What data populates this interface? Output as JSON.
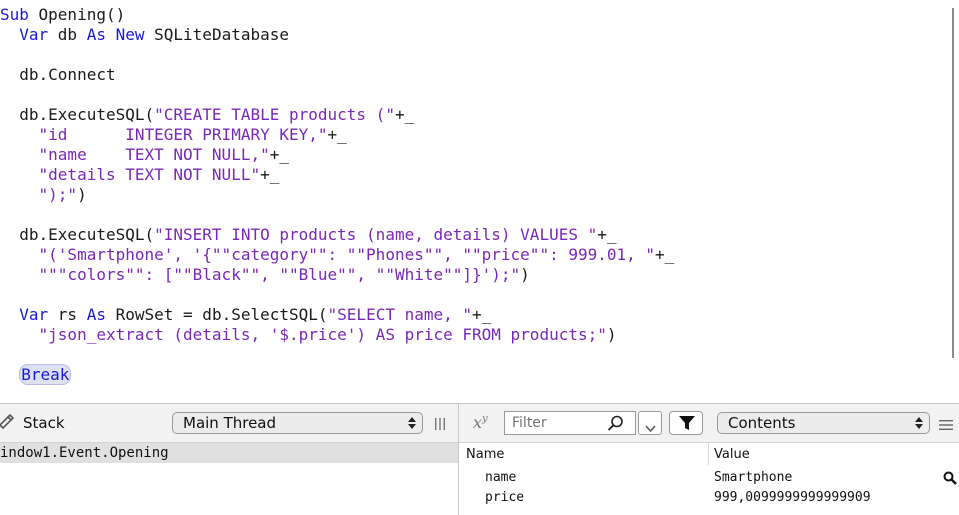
{
  "editor": {
    "lines": [
      [
        {
          "t": "Sub ",
          "c": "kw"
        },
        {
          "t": "Opening()",
          "c": "pl"
        }
      ],
      [
        {
          "t": "  ",
          "c": "pl"
        },
        {
          "t": "Var ",
          "c": "kw"
        },
        {
          "t": "db ",
          "c": "pl"
        },
        {
          "t": "As New ",
          "c": "kw"
        },
        {
          "t": "SQLiteDatabase",
          "c": "pl"
        }
      ],
      [],
      [
        {
          "t": "  db.Connect",
          "c": "pl"
        }
      ],
      [],
      [
        {
          "t": "  db.ExecuteSQL(",
          "c": "pl"
        },
        {
          "t": "\"CREATE TABLE products (\"",
          "c": "str"
        },
        {
          "t": "+_",
          "c": "pl"
        }
      ],
      [
        {
          "t": "    ",
          "c": "pl"
        },
        {
          "t": "\"id      INTEGER PRIMARY KEY,\"",
          "c": "str"
        },
        {
          "t": "+_",
          "c": "pl"
        }
      ],
      [
        {
          "t": "    ",
          "c": "pl"
        },
        {
          "t": "\"name    TEXT NOT NULL,\"",
          "c": "str"
        },
        {
          "t": "+_",
          "c": "pl"
        }
      ],
      [
        {
          "t": "    ",
          "c": "pl"
        },
        {
          "t": "\"details TEXT NOT NULL\"",
          "c": "str"
        },
        {
          "t": "+_",
          "c": "pl"
        }
      ],
      [
        {
          "t": "    ",
          "c": "pl"
        },
        {
          "t": "\");\"",
          "c": "str"
        },
        {
          "t": ")",
          "c": "pl"
        }
      ],
      [],
      [
        {
          "t": "  db.ExecuteSQL(",
          "c": "pl"
        },
        {
          "t": "\"INSERT INTO products (name, details) VALUES \"",
          "c": "str"
        },
        {
          "t": "+_",
          "c": "pl"
        }
      ],
      [
        {
          "t": "    ",
          "c": "pl"
        },
        {
          "t": "\"('Smartphone', '{\"\"category\"\": \"\"Phones\"\", \"\"price\"\": 999.01, \"",
          "c": "str"
        },
        {
          "t": "+_",
          "c": "pl"
        }
      ],
      [
        {
          "t": "    ",
          "c": "pl"
        },
        {
          "t": "\"\"\"colors\"\": [\"\"Black\"\", \"\"Blue\"\", \"\"White\"\"]}');\"",
          "c": "str"
        },
        {
          "t": ")",
          "c": "pl"
        }
      ],
      [],
      [
        {
          "t": "  ",
          "c": "pl"
        },
        {
          "t": "Var ",
          "c": "kw"
        },
        {
          "t": "rs ",
          "c": "pl"
        },
        {
          "t": "As ",
          "c": "kw"
        },
        {
          "t": "RowSet = db.SelectSQL(",
          "c": "pl"
        },
        {
          "t": "\"SELECT name, \"",
          "c": "str"
        },
        {
          "t": "+_",
          "c": "pl"
        }
      ],
      [
        {
          "t": "    ",
          "c": "pl"
        },
        {
          "t": "\"json_extract (details, '$.price') AS price FROM products;\"",
          "c": "str"
        },
        {
          "t": ")",
          "c": "pl"
        }
      ],
      [],
      [
        {
          "t": "  ",
          "c": "pl"
        },
        {
          "t": "Break",
          "c": "brk"
        }
      ]
    ]
  },
  "stack_panel": {
    "title": "Stack",
    "thread_selected": "Main Thread",
    "rows": [
      "indow1.Event.Opening"
    ]
  },
  "variables_panel": {
    "filter_placeholder": "Filter",
    "view_selected": "Contents",
    "col_name": "Name",
    "col_value": "Value",
    "rows": [
      {
        "name": "name",
        "value": "Smartphone"
      },
      {
        "name": "price",
        "value": "999,0099999999999909"
      }
    ]
  },
  "colors": {
    "keyword": "#1a1ad6",
    "string": "#7a28b8",
    "selection": "#e0e0e0"
  }
}
